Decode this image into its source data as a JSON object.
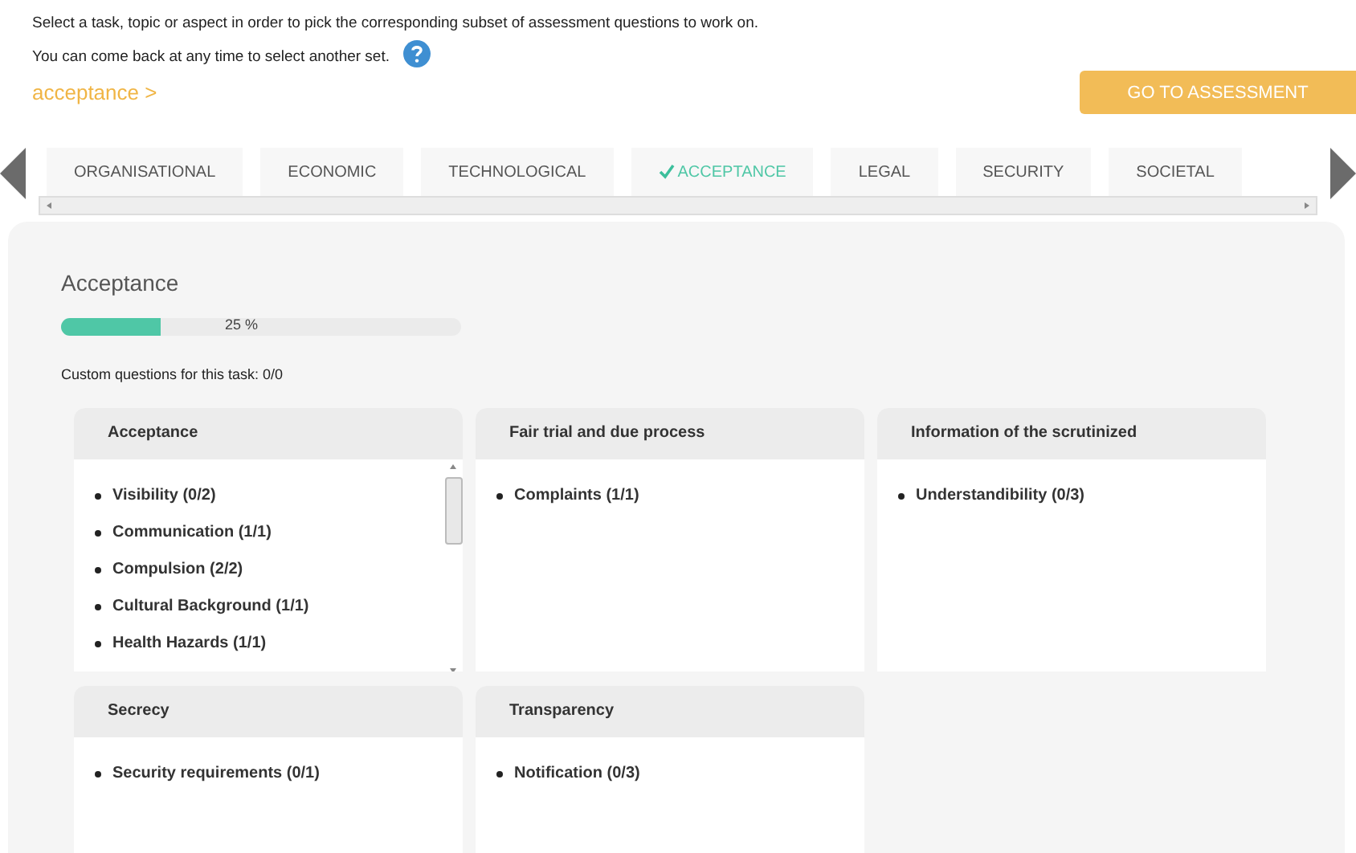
{
  "intro": [
    "Select a task, topic or aspect in order to pick the corresponding subset of assessment questions to work on.",
    "You can come back at any time to select another set."
  ],
  "breadcrumb": "acceptance >",
  "action_button": "GO TO ASSESSMENT",
  "tabs": [
    {
      "label": "ORGANISATIONAL",
      "selected": false
    },
    {
      "label": "ECONOMIC",
      "selected": false
    },
    {
      "label": "TECHNOLOGICAL",
      "selected": false
    },
    {
      "label": "ACCEPTANCE",
      "selected": true
    },
    {
      "label": "LEGAL",
      "selected": false
    },
    {
      "label": "SECURITY",
      "selected": false
    },
    {
      "label": "SOCIETAL",
      "selected": false
    }
  ],
  "panel": {
    "title": "Acceptance",
    "progress": {
      "level": 0.25,
      "reading": "25 %"
    },
    "custom_questions": "Custom questions for this task: 0/0",
    "cards": [
      {
        "title": "Acceptance",
        "scrollable": true,
        "items": [
          "Visibility (0/2)",
          "Communication (1/1)",
          "Compulsion (2/2)",
          "Cultural Background (1/1)",
          "Health Hazards (1/1)"
        ]
      },
      {
        "title": "Fair trial and due process",
        "scrollable": false,
        "items": [
          "Complaints (1/1)"
        ]
      },
      {
        "title": "Information of the scrutinized",
        "scrollable": false,
        "items": [
          "Understandibility (0/3)"
        ]
      },
      {
        "title": "Secrecy",
        "scrollable": false,
        "items": [
          "Security requirements (0/1)"
        ]
      },
      {
        "title": "Transparency",
        "scrollable": false,
        "items": [
          "Notification (0/3)"
        ]
      }
    ]
  }
}
